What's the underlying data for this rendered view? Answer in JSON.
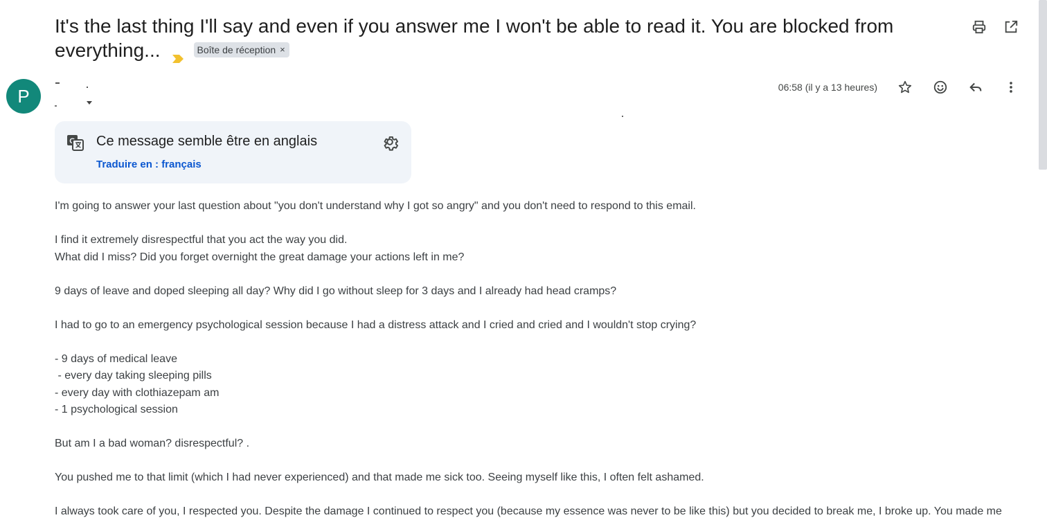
{
  "subject": {
    "text": "It's the last thing I'll say and even if you answer me I won't be able to read it. You are blocked from everything...",
    "label": "Boîte de réception",
    "label_remove": "×"
  },
  "sender": {
    "avatar_letter": "P",
    "timestamp": "06:58 (il y a 13 heures)"
  },
  "translate": {
    "title": "Ce message semble être en anglais",
    "link": "Traduire en : français"
  },
  "body": {
    "lines": [
      "I'm going to answer your last question about \"you don't understand why I got so angry\" and you don't need to respond to this email.",
      "",
      "I find it extremely disrespectful that you act the way you did.",
      "What did I miss? Did you forget overnight the great damage your actions left in me?",
      "",
      "9 days of leave and doped sleeping all day? Why did I go without sleep for 3 days and I already had head cramps?",
      "",
      "I had to go to an emergency psychological session because I had a distress attack and I cried and cried and I wouldn't stop crying?",
      "",
      "- 9 days of medical leave",
      " - every day taking sleeping pills",
      "- every day with clothiazepam am",
      "- 1 psychological session",
      "",
      "But am I a bad woman? disrespectful? .",
      "",
      "You pushed me to that limit (which I had never experienced) and that made me sick too. Seeing myself like this, I often felt ashamed.",
      "",
      "I always took care of you, I respected you. Despite the damage I continued to respect you (because my essence was never to be like this) but you decided to break me, I broke up. You made me"
    ]
  },
  "icons": {
    "print": "print-icon",
    "open_new_window": "open-in-new-window-icon",
    "star": "star-icon",
    "emoji": "emoji-reaction-icon",
    "reply": "reply-icon",
    "more": "more-vert-icon",
    "translate": "translate-icon",
    "settings": "gear-icon",
    "importance": "importance-marker-icon"
  },
  "colors": {
    "avatar_bg": "#12887a",
    "importance": "#f2c12e",
    "translate_bg": "#f0f4f9",
    "link": "#0b57d0",
    "label_chip_bg": "#dde1e6"
  }
}
